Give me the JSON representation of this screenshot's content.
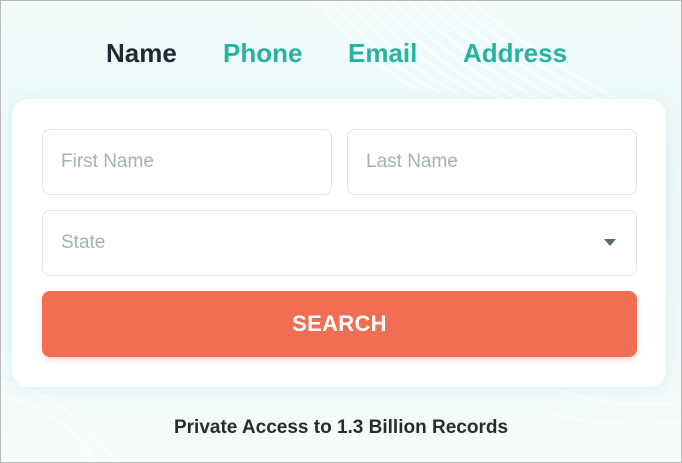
{
  "tabs": {
    "name": "Name",
    "phone": "Phone",
    "email": "Email",
    "address": "Address",
    "active": "Name"
  },
  "form": {
    "first_name_placeholder": "First Name",
    "last_name_placeholder": "Last Name",
    "state_placeholder": "State",
    "search_label": "SEARCH"
  },
  "tagline": "Private Access to 1.3 Billion Records",
  "colors": {
    "accent_teal": "#26b3a0",
    "active_tab": "#1f2a37",
    "search_button": "#f26e52"
  },
  "icons": {
    "state_dropdown": "chevron-down-icon"
  }
}
